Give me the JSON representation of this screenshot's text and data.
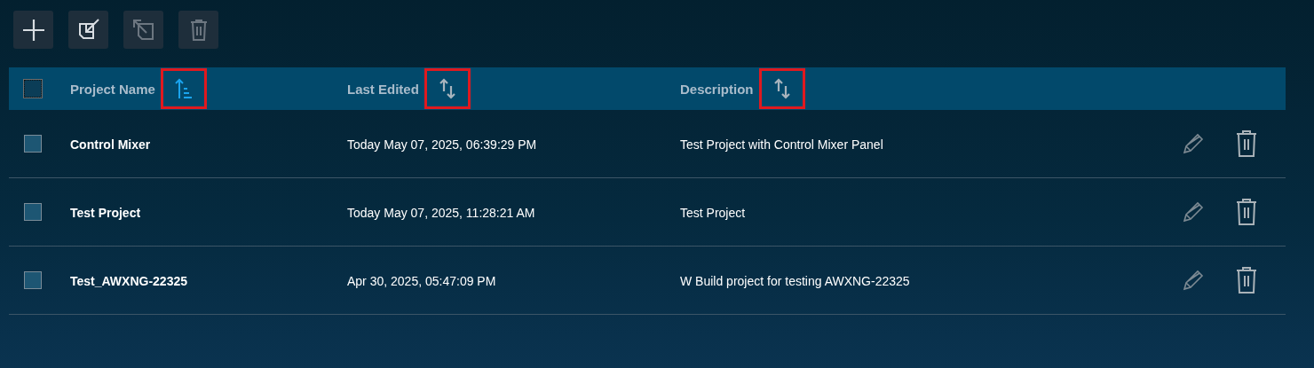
{
  "toolbar": [
    {
      "kind": "add",
      "disabled": false
    },
    {
      "kind": "import",
      "disabled": false
    },
    {
      "kind": "export",
      "disabled": true
    },
    {
      "kind": "delete",
      "disabled": true
    }
  ],
  "table": {
    "select_all": {
      "checked": false
    },
    "columns": [
      {
        "label": "Project Name",
        "kind": "ascending",
        "highlighted": true
      },
      {
        "label": "Last Edited",
        "kind": "unsorted",
        "highlighted": true
      },
      {
        "label": "Description",
        "kind": "unsorted",
        "highlighted": true
      }
    ],
    "rows": [
      {
        "checked": false,
        "cells": [
          "Control Mixer",
          "Today May 07, 2025, 06:39:29 PM",
          "Test Project with Control Mixer Panel"
        ]
      },
      {
        "checked": false,
        "cells": [
          "Test Project",
          "Today May 07, 2025, 11:28:21 AM",
          "Test Project"
        ]
      },
      {
        "checked": false,
        "cells": [
          "Test_AWXNG-22325",
          "Apr 30, 2025, 05:47:09 PM",
          "W Build project for testing AWXNG-22325"
        ]
      }
    ]
  }
}
